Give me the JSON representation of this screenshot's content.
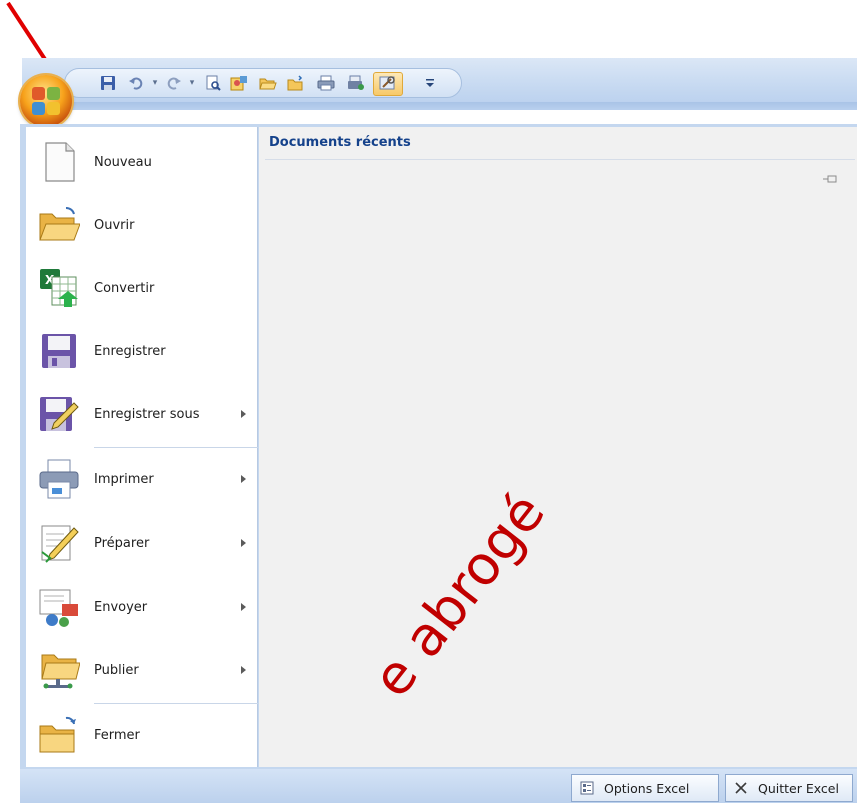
{
  "qat": {
    "icons": [
      "office-logo",
      "save-icon",
      "undo-icon",
      "redo-icon",
      "print-preview-icon",
      "format-icon",
      "open-folder-icon",
      "new-folder-icon",
      "print-icon",
      "tools-icon",
      "customize-icon"
    ]
  },
  "menu": {
    "items": [
      {
        "label": "Nouveau",
        "submenu": false
      },
      {
        "label": "Ouvrir",
        "submenu": false
      },
      {
        "label": "Convertir",
        "submenu": false
      },
      {
        "label": "Enregistrer",
        "submenu": false
      },
      {
        "label": "Enregistrer sous",
        "submenu": true
      },
      {
        "label": "Imprimer",
        "submenu": true
      },
      {
        "label": "Préparer",
        "submenu": true
      },
      {
        "label": "Envoyer",
        "submenu": true
      },
      {
        "label": "Publier",
        "submenu": true
      },
      {
        "label": "Fermer",
        "submenu": false
      }
    ]
  },
  "recent": {
    "header": "Documents récents"
  },
  "footer": {
    "options_label": "Options Excel",
    "quit_label": "Quitter Excel"
  },
  "watermark": {
    "text": "e abrogé"
  },
  "colors": {
    "ribbon_blue": "#c4d7ef",
    "header_blue": "#15428b",
    "arrow_red": "#e00000",
    "watermark_red": "#c00000",
    "office_orange": "#f7a21b"
  }
}
